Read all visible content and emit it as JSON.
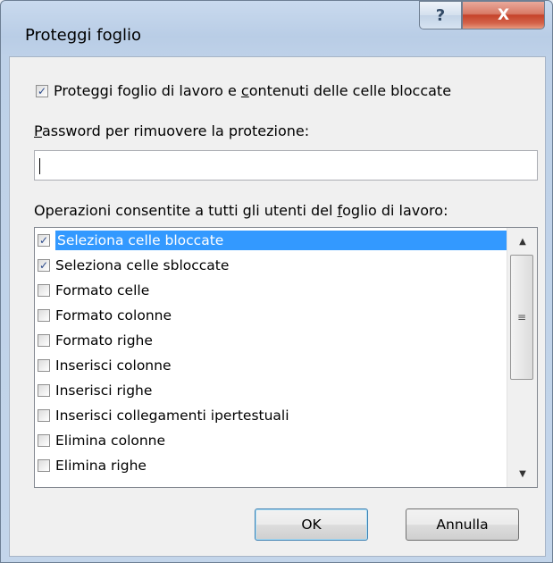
{
  "window": {
    "title": "Proteggi foglio",
    "help_label": "?",
    "close_label": "X"
  },
  "main_checkbox": {
    "checked": true,
    "label_before": "Proteggi foglio di lavoro e ",
    "label_mnemonic": "c",
    "label_after": "ontenuti delle celle bloccate"
  },
  "password": {
    "label_mnemonic": "P",
    "label_rest": "assword per rimuovere la protezione:",
    "value": ""
  },
  "permissions": {
    "label_before": "Operazioni consentite a tutti gli utenti del ",
    "label_mnemonic": "f",
    "label_after": "oglio di lavoro:",
    "items": [
      {
        "label": "Seleziona celle bloccate",
        "checked": true,
        "selected": true
      },
      {
        "label": "Seleziona celle sbloccate",
        "checked": true,
        "selected": false
      },
      {
        "label": "Formato celle",
        "checked": false,
        "selected": false
      },
      {
        "label": "Formato colonne",
        "checked": false,
        "selected": false
      },
      {
        "label": "Formato righe",
        "checked": false,
        "selected": false
      },
      {
        "label": "Inserisci colonne",
        "checked": false,
        "selected": false
      },
      {
        "label": "Inserisci righe",
        "checked": false,
        "selected": false
      },
      {
        "label": "Inserisci collegamenti ipertestuali",
        "checked": false,
        "selected": false
      },
      {
        "label": "Elimina colonne",
        "checked": false,
        "selected": false
      },
      {
        "label": "Elimina righe",
        "checked": false,
        "selected": false
      }
    ]
  },
  "scrollbar": {
    "up_icon": "triangle-up",
    "down_icon": "triangle-down",
    "grip_icon": "grip-lines",
    "position_fraction": 0.0
  },
  "buttons": {
    "ok_label": "OK",
    "cancel_label": "Annulla"
  }
}
